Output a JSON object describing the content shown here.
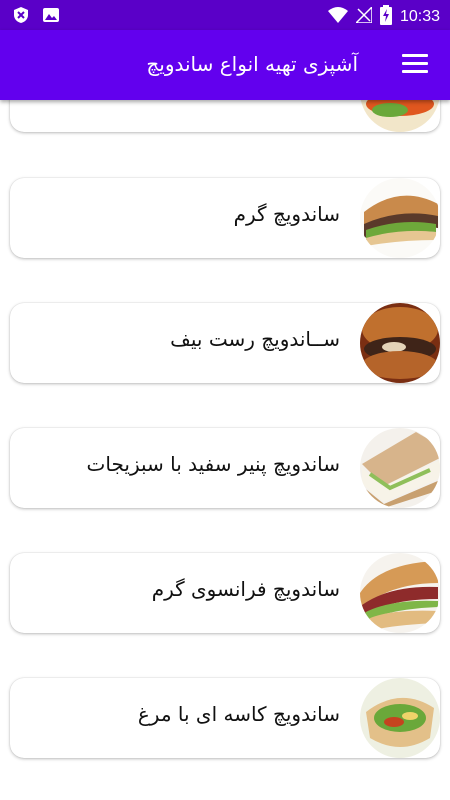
{
  "status_bar": {
    "time": "10:33",
    "left_icons": [
      "shield-x-icon",
      "image-icon"
    ],
    "right_icons": [
      "wifi-icon",
      "no-signal-icon",
      "battery-charging-icon"
    ]
  },
  "app_bar": {
    "title": "آشپزی تهیه انواع ساندویچ",
    "menu_icon": "hamburger-menu-icon",
    "color": "#6200ee"
  },
  "items": [
    {
      "label": ""
    },
    {
      "label": "ساندویچ گرم"
    },
    {
      "label": "ســاندویچ رست بیف"
    },
    {
      "label": "ساندویچ پنیر سفید با سبزیجات"
    },
    {
      "label": "ساندویچ فرانسوی گرم"
    },
    {
      "label": "ساندویچ کاسه ای با مرغ"
    }
  ]
}
